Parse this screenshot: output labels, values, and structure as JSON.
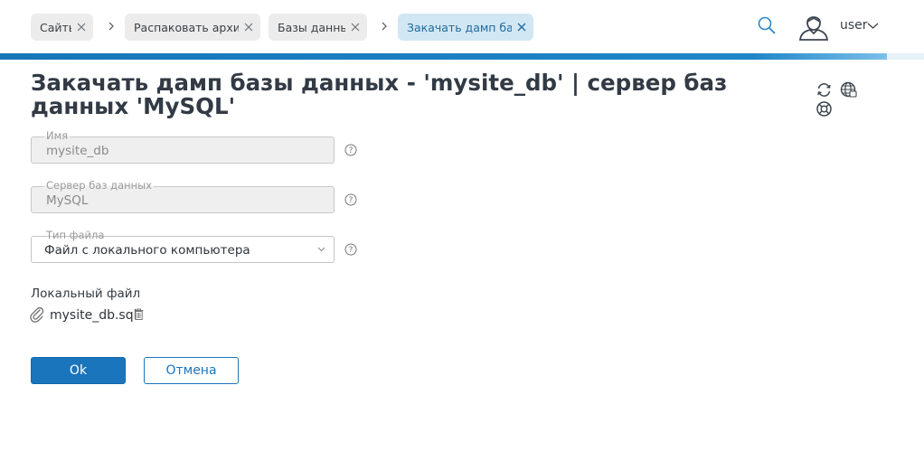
{
  "breadcrumbs": [
    {
      "label": "Сайты"
    },
    {
      "label": "Распаковать архи..."
    },
    {
      "label": "Базы данных"
    },
    {
      "label": "Закачать дамп ба..."
    }
  ],
  "header": {
    "user_name": "user",
    "icons": [
      "search-icon",
      "user-icon",
      "chevron-down-icon"
    ]
  },
  "progress": {
    "percent": 96
  },
  "page": {
    "title": "Закачать дамп базы данных - 'mysite_db' | сервер баз данных 'MySQL'",
    "actions": [
      "refresh-icon",
      "web-icon",
      "help-lifebuoy-icon"
    ]
  },
  "form": {
    "name": {
      "label": "Имя",
      "value": "mysite_db"
    },
    "server": {
      "label": "Сервер баз данных",
      "value": "MySQL"
    },
    "file_type": {
      "label": "Тип файла",
      "value": "Файл с локального компьютера"
    },
    "local_file": {
      "label": "Локальный файл",
      "file_name": "mysite_db.sql"
    }
  },
  "buttons": {
    "ok": "Ok",
    "cancel": "Отмена"
  },
  "colors": {
    "accent": "#1a75bc",
    "active_tab": "#d2e7f4",
    "tab": "#ececec"
  }
}
